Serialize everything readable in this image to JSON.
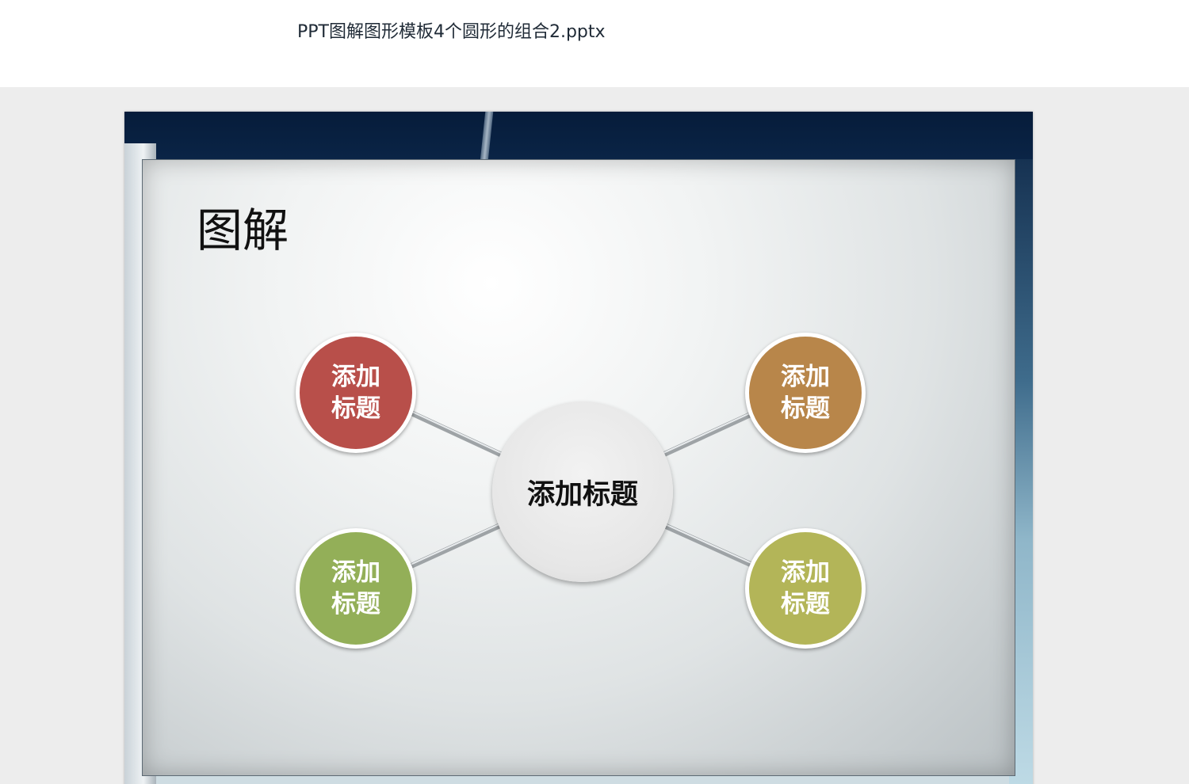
{
  "file": {
    "title": "PPT图解图形模板4个圆形的组合2.pptx"
  },
  "slide": {
    "heading": "图解",
    "center_node": {
      "label": "添加标题"
    },
    "nodes": [
      {
        "label": "添加标题",
        "color": "#b84f4a"
      },
      {
        "label": "添加标题",
        "color": "#b8864a"
      },
      {
        "label": "添加标题",
        "color": "#93af58"
      },
      {
        "label": "添加标题",
        "color": "#b3b558"
      }
    ]
  }
}
